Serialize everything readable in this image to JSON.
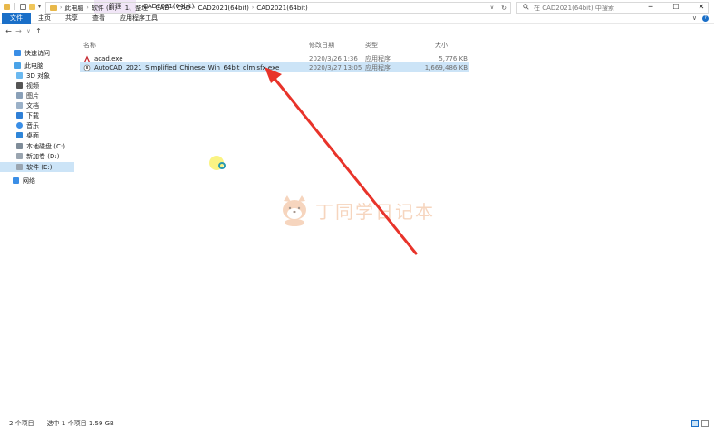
{
  "titlebar": {
    "manage_tab": "管理",
    "title": "CAD2021(64bit)",
    "minimize": "─",
    "maximize": "☐",
    "close": "✕"
  },
  "ribbon": {
    "tabs": [
      "文件",
      "主页",
      "共享",
      "查看",
      "应用程序工具"
    ],
    "collapse": "∨"
  },
  "address": {
    "back": "←",
    "forward": "→",
    "recent": "∨",
    "up": "↑",
    "crumbs": [
      "此电脑",
      "软件 (E:)",
      "1、整理",
      "CAD",
      "CAD",
      "CAD2021(64bit)",
      "CAD2021(64bit)"
    ],
    "dropdown": "∨",
    "refresh": "↻"
  },
  "search": {
    "placeholder": "在 CAD2021(64bit) 中搜索"
  },
  "sidebar": {
    "items": [
      {
        "label": "快速访问",
        "icon": "star-icon"
      },
      {
        "label": "此电脑",
        "icon": "computer-icon"
      },
      {
        "label": "3D 对象",
        "icon": "cube-icon"
      },
      {
        "label": "视频",
        "icon": "video-icon"
      },
      {
        "label": "图片",
        "icon": "picture-icon"
      },
      {
        "label": "文档",
        "icon": "document-icon"
      },
      {
        "label": "下载",
        "icon": "download-icon"
      },
      {
        "label": "音乐",
        "icon": "music-icon"
      },
      {
        "label": "桌面",
        "icon": "desktop-icon"
      },
      {
        "label": "本地磁盘 (C:)",
        "icon": "drive-icon"
      },
      {
        "label": "新加卷 (D:)",
        "icon": "drive-icon"
      },
      {
        "label": "软件 (E:)",
        "icon": "drive-icon"
      },
      {
        "label": "网络",
        "icon": "network-icon"
      }
    ]
  },
  "columns": {
    "name": "名称",
    "date": "修改日期",
    "type": "类型",
    "size": "大小"
  },
  "files": [
    {
      "name": "acad.exe",
      "date": "2020/3/26 1:36",
      "type": "应用程序",
      "size": "5,776 KB",
      "icon": "autocad-icon"
    },
    {
      "name": "AutoCAD_2021_Simplified_Chinese_Win_64bit_dlm.sfx.exe",
      "date": "2020/3/27 13:05",
      "type": "应用程序",
      "size": "1,669,486 KB",
      "icon": "installer-icon"
    }
  ],
  "status": {
    "count": "2 个项目",
    "selected": "选中 1 个项目  1.59 GB"
  },
  "watermark": {
    "text": "丁同学日记本"
  },
  "colors": {
    "accent": "#1a6fc8",
    "selection": "#cce4f7",
    "annotation_arrow": "#e8332a",
    "manage_tab_bg": "#f1e6f7"
  }
}
